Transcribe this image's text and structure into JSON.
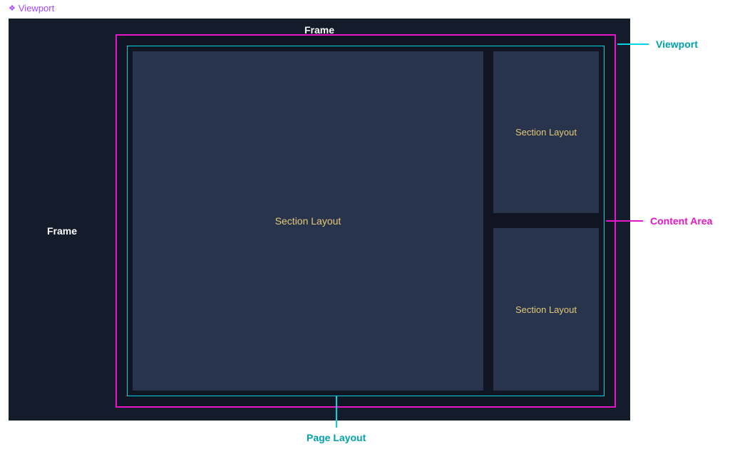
{
  "header": {
    "icon_name": "diamond-icon",
    "label": "Viewport"
  },
  "frame": {
    "top_label": "Frame",
    "left_label": "Frame"
  },
  "sections": {
    "main_label": "Section Layout",
    "right1_label": "Section Layout",
    "right2_label": "Section Layout"
  },
  "callouts": {
    "viewport": "Viewport",
    "content_area": "Content Area",
    "page_layout": "Page Layout"
  },
  "colors": {
    "frame_bg": "#141c2b",
    "viewport_border": "#e516c7",
    "content_border": "#00d5e0",
    "section_bg": "#27344b",
    "section_text": "#e5c978",
    "header_purple": "#a845ff",
    "teal_label": "#00a0ae",
    "magenta_label": "#e516c7"
  }
}
